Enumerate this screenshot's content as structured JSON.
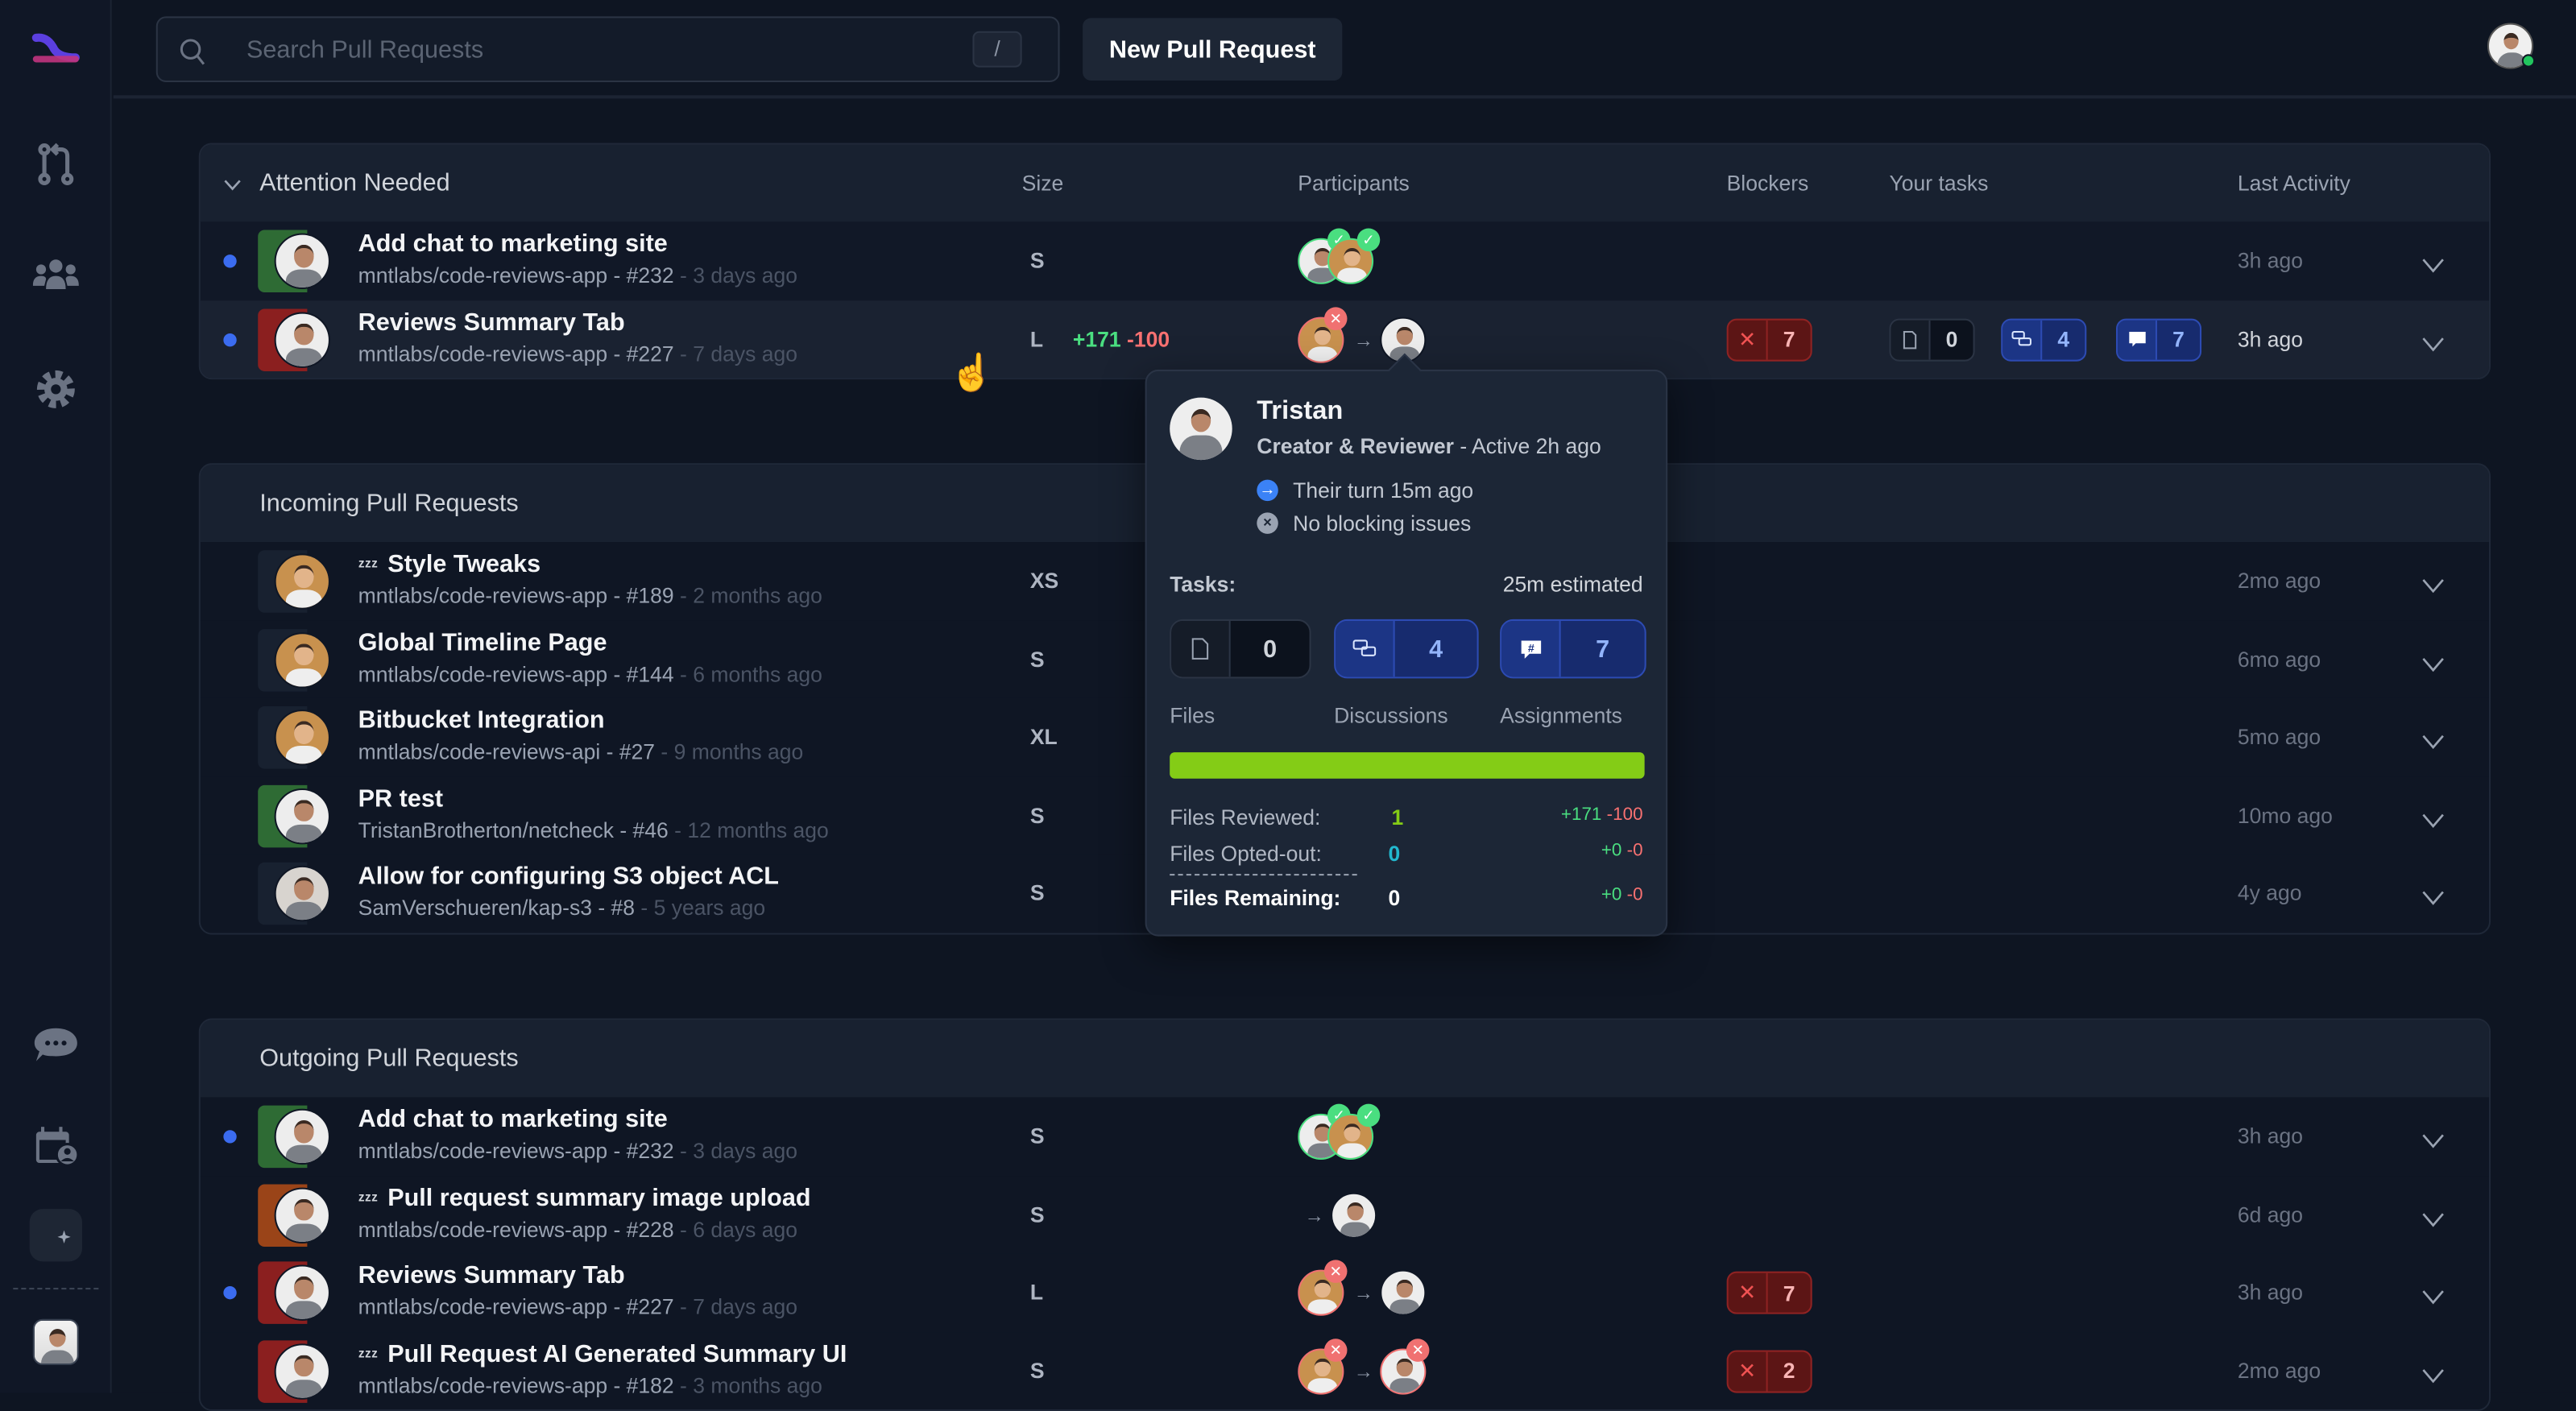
{
  "colors": {
    "accent": "#3b6cf0",
    "approved": "#4ade80",
    "rejected": "#f87171",
    "progress": "#84cc16",
    "opted": "#22b8cf"
  },
  "sidebar": {
    "items": [
      {
        "icon": "logo-icon"
      },
      {
        "icon": "pull-request-icon"
      },
      {
        "icon": "team-icon"
      },
      {
        "icon": "gear-icon"
      },
      {
        "icon": "chat-bubble-icon"
      },
      {
        "icon": "calendar-user-icon"
      },
      {
        "icon": "theme-toggle-icon"
      },
      {
        "icon": "user-avatar"
      }
    ]
  },
  "topbar": {
    "search_placeholder": "Search Pull Requests",
    "search_shortcut": "/",
    "new_pr_label": "New Pull Request"
  },
  "columns": {
    "size": "Size",
    "participants": "Participants",
    "blockers": "Blockers",
    "tasks": "Your tasks",
    "activity": "Last Activity"
  },
  "sections": [
    {
      "title": "Attention Needed",
      "collapsible": true,
      "rows": [
        {
          "title": "Add chat to marketing site",
          "repo": "mntlabs/code-reviews-app - #232",
          "age": " - 3 days ago",
          "size": "S",
          "dot": true,
          "strip": "#2e6b34",
          "avatar": "white",
          "participants": {
            "stack": [
              {
                "a": "white",
                "s": "approved"
              },
              {
                "a": "tan",
                "s": "approved"
              }
            ]
          },
          "activity": "3h ago"
        },
        {
          "title": "Reviews Summary Tab",
          "repo": "mntlabs/code-reviews-app - #227",
          "age": " - 7 days ago",
          "size": "L",
          "adds": "+171",
          "dels": "-100",
          "dot": true,
          "strip": "#8b1f1f",
          "avatar": "white",
          "participants": {
            "from": {
              "a": "tan",
              "s": "rejected"
            },
            "to": {
              "a": "white"
            }
          },
          "blockers": "7",
          "tasks": {
            "files": "0",
            "discussions": "4",
            "assignments": "7"
          },
          "activity": "3h ago",
          "hover": true
        }
      ]
    },
    {
      "title": "Incoming Pull Requests",
      "rows": [
        {
          "title": "Style Tweaks",
          "snooze": true,
          "repo": "mntlabs/code-reviews-app - #189",
          "age": " - 2 months ago",
          "size": "XS",
          "strip": "#182130",
          "avatar": "tan",
          "activity": "2mo ago"
        },
        {
          "title": "Global Timeline Page",
          "repo": "mntlabs/code-reviews-app - #144",
          "age": " - 6 months ago",
          "size": "S",
          "strip": "#182130",
          "avatar": "tan",
          "activity": "6mo ago"
        },
        {
          "title": "Bitbucket Integration",
          "repo": "mntlabs/code-reviews-api - #27",
          "age": " - 9 months ago",
          "size": "XL",
          "strip": "#182130",
          "avatar": "tan",
          "activity": "5mo ago"
        },
        {
          "title": "PR test",
          "repo": "TristanBrotherton/netcheck - #46",
          "age": " - 12 months ago",
          "size": "S",
          "strip": "#2e6b34",
          "avatar": "white",
          "activity": "10mo ago"
        },
        {
          "title": "Allow for configuring S3 object ACL",
          "repo": "SamVerschueren/kap-s3 - #8",
          "age": " - 5 years ago",
          "size": "S",
          "strip": "#182130",
          "avatar": "gray",
          "activity": "4y ago"
        }
      ]
    },
    {
      "title": "Outgoing Pull Requests",
      "rows": [
        {
          "title": "Add chat to marketing site",
          "repo": "mntlabs/code-reviews-app - #232",
          "age": " - 3 days ago",
          "size": "S",
          "dot": true,
          "strip": "#2e6b34",
          "avatar": "white",
          "participants": {
            "stack": [
              {
                "a": "white",
                "s": "approved"
              },
              {
                "a": "tan",
                "s": "approved"
              }
            ]
          },
          "activity": "3h ago"
        },
        {
          "title": "Pull request summary image upload",
          "snooze": true,
          "repo": "mntlabs/code-reviews-app - #228",
          "age": " - 6 days ago",
          "size": "S",
          "strip": "#9a4418",
          "avatar": "white",
          "participants": {
            "to": {
              "a": "white"
            }
          },
          "activity": "6d ago"
        },
        {
          "title": "Reviews Summary Tab",
          "repo": "mntlabs/code-reviews-app - #227",
          "age": " - 7 days ago",
          "size": "L",
          "dot": true,
          "strip": "#8b1f1f",
          "avatar": "white",
          "participants": {
            "from": {
              "a": "tan",
              "s": "rejected"
            },
            "to": {
              "a": "white"
            }
          },
          "blockers": "7",
          "activity": "3h ago"
        },
        {
          "title": "Pull Request AI Generated Summary UI",
          "snooze": true,
          "repo": "mntlabs/code-reviews-app - #182",
          "age": " - 3 months ago",
          "size": "S",
          "strip": "#8b1f1f",
          "avatar": "white",
          "participants": {
            "from": {
              "a": "tan",
              "s": "rejected"
            },
            "to": {
              "a": "white",
              "s": "rejected"
            }
          },
          "blockers": "2",
          "activity": "2mo ago"
        }
      ]
    }
  ],
  "popover": {
    "name": "Tristan",
    "role": "Creator & Reviewer",
    "active": " - Active 2h ago",
    "turn": "Their turn 15m ago",
    "blocking": "No blocking issues",
    "tasks_label": "Tasks:",
    "estimate": "25m estimated",
    "files": "0",
    "discussions": "4",
    "assignments": "7",
    "files_label": "Files",
    "discussions_label": "Discussions",
    "assignments_label": "Assignments",
    "progress_percent": 100,
    "reviewed_label": "Files Reviewed:",
    "reviewed": "1",
    "reviewed_add": "+171",
    "reviewed_del": "-100",
    "opted_label": "Files Opted-out:",
    "opted": "0",
    "opted_add": "+0",
    "opted_del": "-0",
    "remaining_label": "Files Remaining:",
    "remaining": "0",
    "remaining_add": "+0",
    "remaining_del": "-0"
  }
}
